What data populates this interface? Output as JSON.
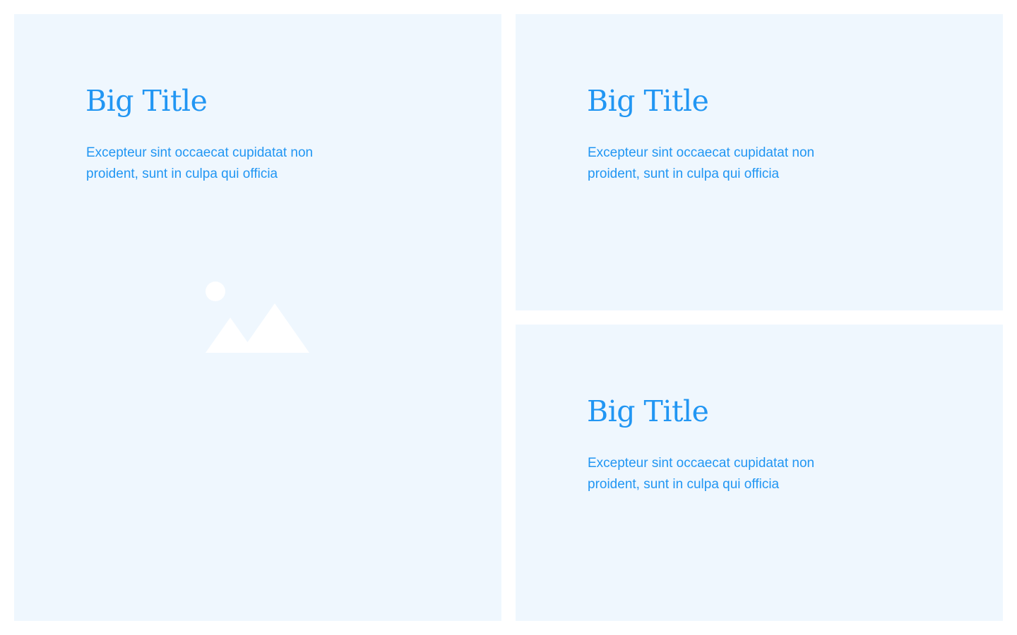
{
  "cards": [
    {
      "title": "Big Title",
      "description": "Excepteur sint occaecat cupidatat non proident, sunt in culpa qui officia",
      "image_icon": "image-placeholder-icon"
    },
    {
      "title": "Big Title",
      "description": "Excepteur sint occaecat cupidatat non proident, sunt in culpa qui officia"
    },
    {
      "title": "Big Title",
      "description": "Excepteur sint occaecat cupidatat non proident, sunt in culpa qui officia"
    }
  ],
  "colors": {
    "page_background": "#ffffff",
    "card_background": "#eff7fe",
    "text_accent": "#2196f3",
    "icon_fill": "#ffffff"
  }
}
